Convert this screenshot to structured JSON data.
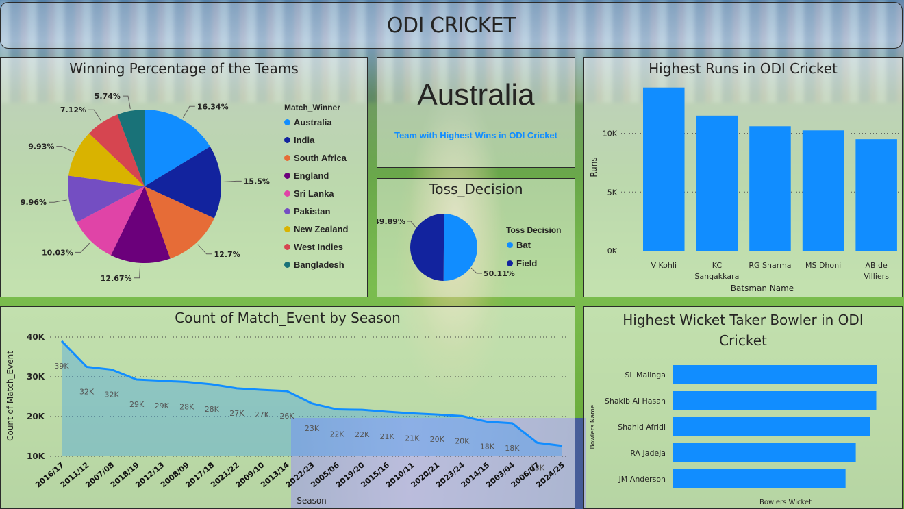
{
  "header": {
    "title": "ODI CRICKET"
  },
  "card": {
    "value": "Australia",
    "label": "Team with Highest Wins in ODI Cricket"
  },
  "win_pct": {
    "title": "Winning Percentage of the Teams",
    "legend_title": "Match_Winner",
    "labels": [
      "16.34%",
      "15.5%",
      "12.7%",
      "12.67%",
      "10.03%",
      "9.96%",
      "9.93%",
      "7.12%",
      "5.74%"
    ]
  },
  "toss": {
    "title": "Toss_Decision",
    "legend_title": "Toss Decision",
    "labels": [
      "50.11%",
      "49.89%"
    ]
  },
  "runs": {
    "title": "Highest Runs in ODI Cricket",
    "ylabel": "Runs",
    "xlabel": "Batsman Name",
    "ticks": [
      "0K",
      "5K",
      "10K"
    ]
  },
  "matches": {
    "title": "Count of Match_Event by Season",
    "ylabel": "Count of Match_Event",
    "xlabel": "Season",
    "ticks": [
      "10K",
      "20K",
      "30K",
      "40K"
    ]
  },
  "wickets": {
    "title": "Highest Wicket Taker Bowler in ODI Cricket",
    "ylabel": "Bowlers Name",
    "xlabel": "Bowlers Wicket"
  },
  "chart_data": [
    {
      "type": "pie",
      "title": "Winning Percentage of the Teams",
      "legend_title": "Match_Winner",
      "categories": [
        "Australia",
        "India",
        "South Africa",
        "England",
        "Sri Lanka",
        "Pakistan",
        "New Zealand",
        "West Indies",
        "Bangladesh"
      ],
      "values": [
        16.34,
        15.5,
        12.7,
        12.67,
        10.03,
        9.96,
        9.93,
        7.12,
        5.74
      ],
      "colors": [
        "#118dff",
        "#12239e",
        "#e66c37",
        "#6b007b",
        "#e044a7",
        "#744ec2",
        "#d9b300",
        "#d64550",
        "#197278"
      ],
      "legend": "right"
    },
    {
      "type": "pie",
      "title": "Toss_Decision",
      "legend_title": "Toss Decision",
      "categories": [
        "Bat",
        "Field"
      ],
      "values": [
        50.11,
        49.89
      ],
      "colors": [
        "#118dff",
        "#12239e"
      ],
      "legend": "right"
    },
    {
      "type": "bar",
      "title": "Highest Runs in ODI Cricket",
      "categories": [
        "V Kohli",
        "KC Sangakkara",
        "RG Sharma",
        "MS Dhoni",
        "AB de Villiers"
      ],
      "values": [
        13900,
        11500,
        10600,
        10250,
        9500
      ],
      "xlabel": "Batsman Name",
      "ylabel": "Runs",
      "ylim": [
        0,
        14000
      ],
      "yticks": [
        0,
        5000,
        10000
      ],
      "color": "#118dff",
      "grid": true
    },
    {
      "type": "area",
      "title": "Count of Match_Event by Season",
      "categories": [
        "2016/17",
        "2011/12",
        "2007/08",
        "2018/19",
        "2012/13",
        "2008/09",
        "2017/18",
        "2021/22",
        "2009/10",
        "2013/14",
        "2022/23",
        "2005/06",
        "2019/20",
        "2015/16",
        "2010/11",
        "2020/21",
        "2023/24",
        "2014/15",
        "2003/04",
        "2006/07",
        "2024/25"
      ],
      "values": [
        39000,
        32500,
        31800,
        29300,
        29000,
        28700,
        28100,
        27100,
        26700,
        26400,
        23300,
        21800,
        21700,
        21200,
        20800,
        20500,
        20100,
        18700,
        18300,
        13400,
        12600
      ],
      "data_labels": [
        "39K",
        "32K",
        "32K",
        "29K",
        "29K",
        "28K",
        "28K",
        "27K",
        "27K",
        "26K",
        "23K",
        "22K",
        "22K",
        "21K",
        "21K",
        "20K",
        "20K",
        "18K",
        "18K",
        "13K",
        ""
      ],
      "xlabel": "Season",
      "ylabel": "Count of Match_Event",
      "ylim": [
        10000,
        40000
      ],
      "yticks": [
        10000,
        20000,
        30000,
        40000
      ],
      "color": "#118dff",
      "grid": true
    },
    {
      "type": "bar",
      "orientation": "horizontal",
      "title": "Highest Wicket Taker Bowler in ODI Cricket",
      "categories": [
        "SL Malinga",
        "Shakib Al Hasan",
        "Shahid Afridi",
        "RA Jadeja",
        "JM Anderson"
      ],
      "values": [
        1.0,
        0.995,
        0.965,
        0.895,
        0.845
      ],
      "xlabel": "Bowlers Wicket",
      "ylabel": "Bowlers Name",
      "color": "#118dff"
    }
  ]
}
